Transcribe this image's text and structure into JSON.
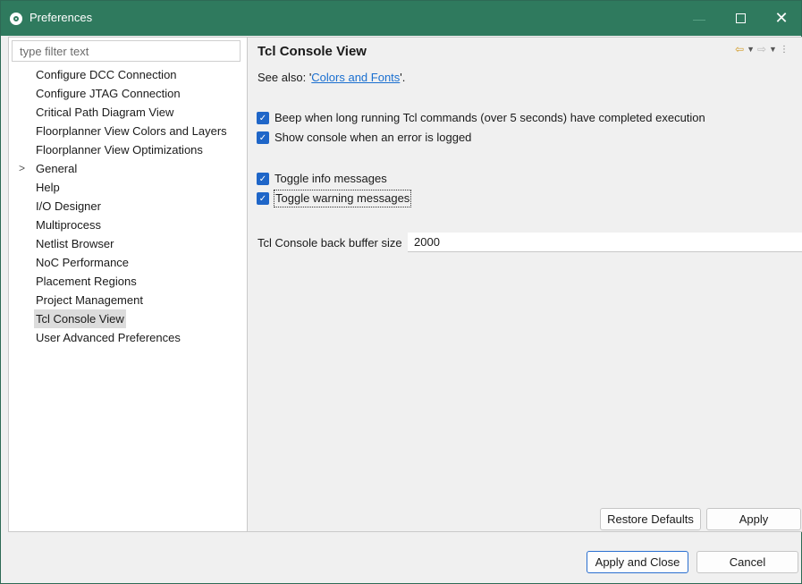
{
  "window": {
    "title": "Preferences",
    "controls": {
      "minimize": "—",
      "maximize": "",
      "close": "✕"
    }
  },
  "sidebar": {
    "filter_placeholder": "type filter text",
    "filter_value": "",
    "items": [
      {
        "label": "Configure DCC Connection",
        "expandable": false,
        "selected": false
      },
      {
        "label": "Configure JTAG Connection",
        "expandable": false,
        "selected": false
      },
      {
        "label": "Critical Path Diagram View",
        "expandable": false,
        "selected": false
      },
      {
        "label": "Floorplanner View Colors and Layers",
        "expandable": false,
        "selected": false
      },
      {
        "label": "Floorplanner View Optimizations",
        "expandable": false,
        "selected": false
      },
      {
        "label": "General",
        "expandable": true,
        "selected": false
      },
      {
        "label": "Help",
        "expandable": false,
        "selected": false
      },
      {
        "label": "I/O Designer",
        "expandable": false,
        "selected": false
      },
      {
        "label": "Multiprocess",
        "expandable": false,
        "selected": false
      },
      {
        "label": "Netlist Browser",
        "expandable": false,
        "selected": false
      },
      {
        "label": "NoC Performance",
        "expandable": false,
        "selected": false
      },
      {
        "label": "Placement Regions",
        "expandable": false,
        "selected": false
      },
      {
        "label": "Project Management",
        "expandable": false,
        "selected": false
      },
      {
        "label": "Tcl Console View",
        "expandable": false,
        "selected": true
      },
      {
        "label": "User Advanced Preferences",
        "expandable": false,
        "selected": false
      }
    ],
    "expander_glyph": ">"
  },
  "main": {
    "title": "Tcl Console View",
    "see_also_prefix": "See also: '",
    "see_also_link": "Colors and Fonts",
    "see_also_suffix": "'.",
    "options": [
      {
        "label": "Beep when long running Tcl commands (over 5 seconds) have completed execution",
        "checked": true
      },
      {
        "label": "Show console when an error is logged",
        "checked": true
      },
      {
        "label": "Toggle info messages",
        "checked": true
      },
      {
        "label": "Toggle warning messages",
        "checked": true
      }
    ],
    "buffer_label": "Tcl Console back buffer size",
    "buffer_value": "2000",
    "restore_defaults": "Restore Defaults",
    "apply": "Apply"
  },
  "footer": {
    "apply_and_close": "Apply and Close",
    "cancel": "Cancel"
  },
  "icons": {
    "back": "⇦",
    "forward": "⇨",
    "dropdown": "▼",
    "more": "⋮",
    "check": "✓"
  },
  "colors": {
    "titlebar": "#2f7a5e",
    "checkbox": "#1f66c8",
    "link": "#1a6fd0",
    "default_button_border": "#2a6fd0"
  }
}
